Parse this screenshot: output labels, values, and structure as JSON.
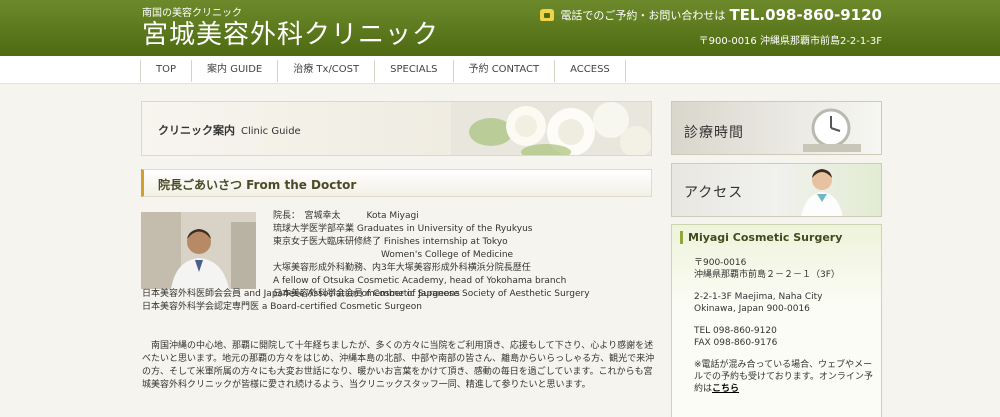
{
  "header": {
    "tagline": "南国の美容クリニック",
    "logo": "宮城美容外科クリニック",
    "phone_label": "電話でのご予約・お問い合わせは",
    "phone_number": "TEL.098-860-9120",
    "address": "〒900-0016 沖縄県那覇市前島2-2-1-3F"
  },
  "nav": [
    "TOP",
    "案内 GUIDE",
    "治療 Tx/COST",
    "SPECIALS",
    "予約 CONTACT",
    "ACCESS"
  ],
  "banner": {
    "title": "クリニック案内",
    "subtitle": "Clinic Guide"
  },
  "section": {
    "title": "院長ごあいさつ From the Doctor"
  },
  "profile": {
    "name_line_label": "院長：　宮城幸太",
    "name_en": "Kota Miyagi",
    "lines": [
      "琉球大学医学部卒業 Graduates in University of the Ryukyus",
      "東京女子医大臨床研修終了 Finishes internship at Tokyo",
      "　　　　　　　　　　　　Women's College of Medicine",
      "大塚美容形成外科勤務、内3年大塚美容形成外科横浜分院長歴任",
      "A fellow of Otsuka Cosmetic Academy, head of Yokohama branch",
      "日本美容外科学会会員 member of Japanese Society of Aesthetic Surgery"
    ],
    "lines_lower": [
      "日本美容外科医師会会員 and Japanese Association of Cosmetic Surgeons",
      "日本美容外科学会認定専門医 a Board-certified Cosmetic Surgeon"
    ]
  },
  "intro": "　南国沖縄の中心地、那覇に開院して十年経ちましたが、多くの方々に当院をご利用頂き、応援もして下さり、心より感謝を述べたいと思います。地元の那覇の方々をはじめ、沖縄本島の北部、中部や南部の皆さん、離島からいらっしゃる方、観光で来沖の方、そして米軍所属の方々にも大変お世話になり、暖かいお言葉をかけて頂き、感動の毎日を過ごしています。これからも宮城美容外科クリニックが皆様に愛され続けるよう、当クリニックスタッフ一同、精進して参りたいと思います。",
  "sidebar": {
    "hours_label": "診療時間",
    "access_label": "アクセス",
    "info_title": "Miyagi Cosmetic Surgery",
    "info_jp_zip": "〒900-0016",
    "info_jp_addr": "沖縄県那覇市前島２－２－１（3F）",
    "info_en_1": "2-2-1-3F Maejima, Naha City",
    "info_en_2": "Okinawa, Japan 900-0016",
    "tel": "TEL 098-860-9120",
    "fax": "FAX 098-860-9176",
    "note": "※電話が混み合っている場合、ウェブやメールでの予約も受けております。オンライン予約は",
    "note_link": "こちら"
  },
  "colors": {
    "header_green": "#5a7619",
    "accent_gold": "#d0a02d"
  }
}
